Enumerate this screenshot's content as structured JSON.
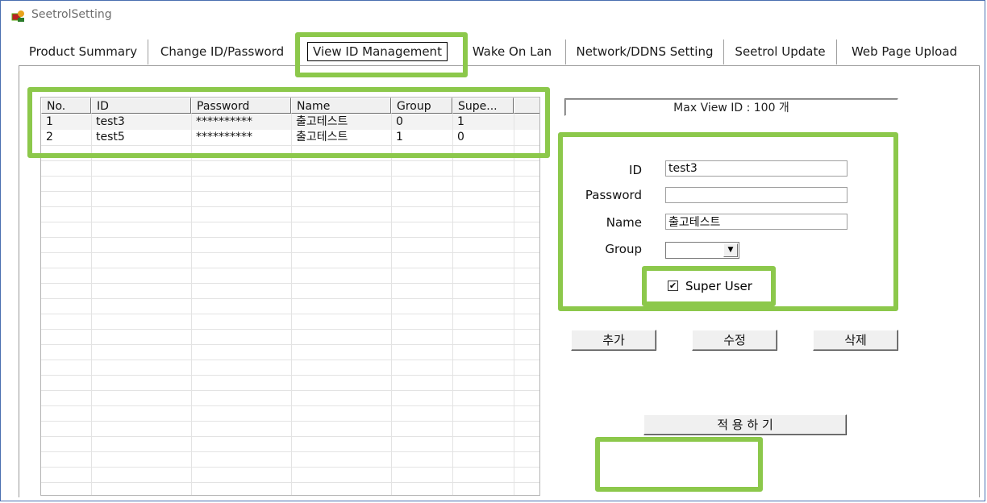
{
  "window": {
    "title": "SeetrolSetting"
  },
  "tabs": [
    {
      "label": "Product Summary"
    },
    {
      "label": "Change ID/Password"
    },
    {
      "label": "View ID Management"
    },
    {
      "label": "Wake On Lan"
    },
    {
      "label": "Network/DDNS Setting"
    },
    {
      "label": "Seetrol Update"
    },
    {
      "label": "Web Page Upload"
    }
  ],
  "list": {
    "columns": [
      "No.",
      "ID",
      "Password",
      "Name",
      "Group",
      "Supe..."
    ],
    "rows": [
      {
        "no": "1",
        "id": "test3",
        "password": "**********",
        "name": "출고테스트",
        "group": "0",
        "super": "1"
      },
      {
        "no": "2",
        "id": "test5",
        "password": "**********",
        "name": "출고테스트",
        "group": "1",
        "super": "0"
      }
    ]
  },
  "max_view_id": "Max View ID : 100 개",
  "form": {
    "id_label": "ID",
    "id_value": "test3",
    "password_label": "Password",
    "password_value": "",
    "name_label": "Name",
    "name_value": "출고테스트",
    "group_label": "Group",
    "group_value": "",
    "super_user_label": "Super User",
    "super_user_checked": true
  },
  "buttons": {
    "add": "추가",
    "edit": "수정",
    "delete": "삭제",
    "apply": "적 용 하 기"
  },
  "colors": {
    "highlight": "#8cc84b",
    "window_border": "#4a6fb0"
  }
}
